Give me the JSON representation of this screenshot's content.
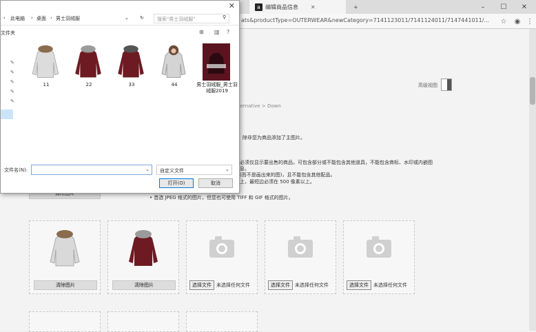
{
  "browser": {
    "tab_label": "编辑商品信息",
    "tab_icon": "a",
    "url": "ats&productType=OUTERWEAR&newCategory=7141123011/7141124011/7147441011/...",
    "advanced_label": "高级视图"
  },
  "page": {
    "breadcrumb": "ternative > Down",
    "notice_main": "除非您为商品添加了主图片。",
    "req_line1": "必须仅显示要出售的商品，可包含部分或不能包含其他道具，不能包含商标、水印或内嵌图",
    "req_line2": "息。",
    "req_line3": "(而不是画出来的图)，且不能包含其他配品。",
    "req_line4": "上，最短边必须在 500 像素以上。",
    "bullet": "首选 JPEG 格式的图片，但您也可使用 TIFF 和 GIF 格式的图片。",
    "top_slot_btn": "清除图片",
    "slots": [
      {
        "kind": "white-jacket",
        "clear": "清除图片"
      },
      {
        "kind": "red-jacket",
        "clear": "清除图片"
      },
      {
        "kind": "empty",
        "choose": "选择文件",
        "nofile": "未选择任何文件"
      },
      {
        "kind": "empty",
        "choose": "选择文件",
        "nofile": "未选择任何文件"
      },
      {
        "kind": "empty",
        "choose": "选择文件",
        "nofile": "未选择任何文件"
      }
    ]
  },
  "dialog": {
    "path": [
      "此电脑",
      "桌面",
      "男士羽绒服"
    ],
    "search_placeholder": "搜索\"男士羽绒服\"",
    "folder_label": "文件夹",
    "files": [
      {
        "name": "11",
        "kind": "white-jacket"
      },
      {
        "name": "22",
        "kind": "red-jacket"
      },
      {
        "name": "33",
        "kind": "red-jacket"
      },
      {
        "name": "44",
        "kind": "white-jacket-kid"
      },
      {
        "name": "男士羽绒服_男士羽绒服2019",
        "kind": "poster"
      }
    ],
    "filename_label": "文件名(N):",
    "filename_value": "",
    "filetype": "自定义文件",
    "open_btn": "打开(O)",
    "cancel_btn": "取消"
  },
  "colors": {
    "accent": "#0078d7",
    "jacket_red": "#6e1a22"
  }
}
